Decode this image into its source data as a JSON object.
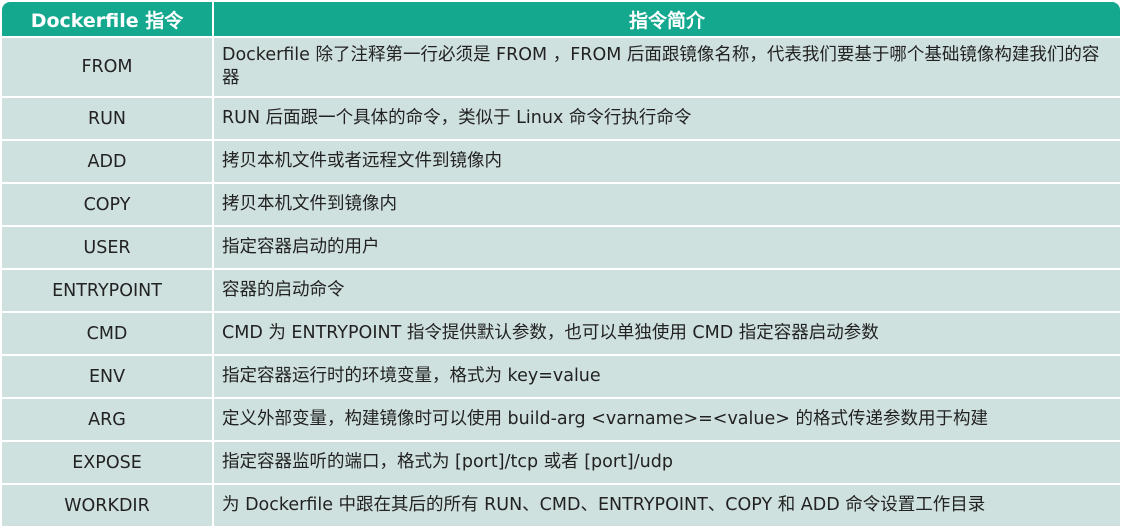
{
  "table": {
    "headers": [
      "Dockerfile 指令",
      "指令简介"
    ],
    "rows": [
      {
        "cmd": "FROM",
        "desc": "Dockerfile 除了注释第一行必须是 FROM ，FROM 后面跟镜像名称，代表我们要基于哪个基础镜像构建我们的容器"
      },
      {
        "cmd": "RUN",
        "desc": "RUN 后面跟一个具体的命令，类似于 Linux 命令行执行命令"
      },
      {
        "cmd": "ADD",
        "desc": "拷贝本机文件或者远程文件到镜像内"
      },
      {
        "cmd": "COPY",
        "desc": "拷贝本机文件到镜像内"
      },
      {
        "cmd": "USER",
        "desc": "指定容器启动的用户"
      },
      {
        "cmd": "ENTRYPOINT",
        "desc": "容器的启动命令"
      },
      {
        "cmd": "CMD",
        "desc": "CMD 为 ENTRYPOINT 指令提供默认参数，也可以单独使用 CMD 指定容器启动参数"
      },
      {
        "cmd": "ENV",
        "desc": "指定容器运行时的环境变量，格式为 key=value"
      },
      {
        "cmd": "ARG",
        "desc": "定义外部变量，构建镜像时可以使用 build-arg <varname>=<value> 的格式传递参数用于构建"
      },
      {
        "cmd": "EXPOSE",
        "desc": "指定容器监听的端口，格式为 [port]/tcp 或者 [port]/udp"
      },
      {
        "cmd": "WORKDIR",
        "desc": "为 Dockerfile 中跟在其后的所有 RUN、CMD、ENTRYPOINT、COPY 和 ADD 命令设置工作目录"
      }
    ]
  },
  "colors": {
    "header_bg": "#14a88f",
    "row_bg": "#cfe1df",
    "header_text": "#ffffff"
  }
}
